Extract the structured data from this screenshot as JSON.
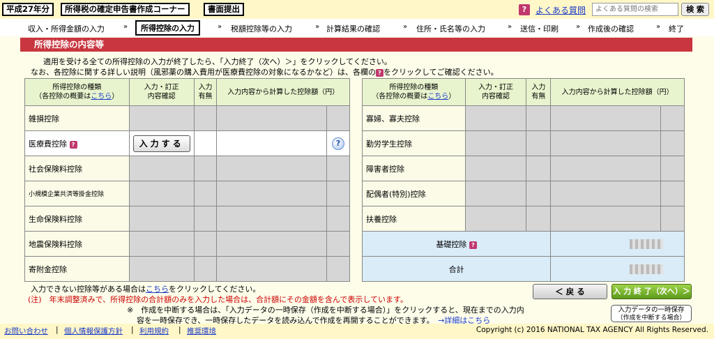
{
  "header": {
    "era": "平成27年分",
    "title": "所得税の確定申告書作成コーナー",
    "doc": "書面提出",
    "faq_icon": "?",
    "faq": "よくある質問",
    "search_placeholder": "よくある質問の検索",
    "search_btn": "検 索"
  },
  "nav": {
    "steps": [
      "収入・所得金額の入力",
      "所得控除の入力",
      "税額控除等の入力",
      "計算結果の確認",
      "住所・氏名等の入力",
      "送信・印刷",
      "作成後の確認",
      "終了"
    ],
    "arrow": "»"
  },
  "section": {
    "title": "所得控除の内容等",
    "intro1": "適用を受ける全ての所得控除の入力が終了したら、「入力終了（次へ）＞」をクリックしてください。",
    "intro2a": "なお、各控除に関する詳しい説明（風邪薬の購入費用が医療費控除の対象になるかなど）は、各欄の",
    "intro2b": "をクリックしてご確認ください。"
  },
  "table_headers": {
    "kind1": "所得控除の種類",
    "kind2a": "（各控除の概要は",
    "kind_link": "こちら",
    "kind2b": "）",
    "check1": "入力・訂正",
    "check2": "内容確認",
    "has1": "入力",
    "has2": "有無",
    "amount": "入力内容から計算した控除額（円）"
  },
  "left_rows": [
    "雑損控除",
    "医療費控除",
    "社会保険料控除",
    "小規模企業共済等掛金控除",
    "生命保険料控除",
    "地震保険料控除",
    "寄附金控除"
  ],
  "right_rows": [
    "寡婦、寡夫控除",
    "勤労学生控除",
    "障害者控除",
    "配偶者(特別)控除",
    "扶養控除"
  ],
  "input_btn": "入力する",
  "hint_icon": "?",
  "basic": "基礎控除",
  "total": "合計",
  "notes": {
    "line1a": "入力できない控除等がある場合は",
    "line1_link": "こちら",
    "line1b": "をクリックしてください。",
    "line2": "(注)　年末調整済みで、所得控除の合計額のみを入力した場合は、合計額にその金額を含んで表示しています。",
    "line3": "※　作成を中断する場合は、「入力データの一時保存（作成を中断する場合）」をクリックすると、現在までの入力内",
    "line4": "容を一時保存でき、一時保存したデータを読み込んで作成を再開することができます。",
    "detail_link": "→詳細はこちら"
  },
  "buttons": {
    "back": "＜ 戻 る",
    "next": "入 力 終 了（次へ）＞",
    "save1": "入力データの一時保存",
    "save2": "（作成を中断する場合）"
  },
  "footer": {
    "links": [
      "お問い合わせ",
      "個人情報保護方針",
      "利用規約",
      "推奨環境"
    ],
    "separator": "|",
    "copyright": "Copyright (c) 2016 NATIONAL TAX AGENCY All Rights Reserved."
  },
  "colors": {
    "section_red": "#c9363f",
    "header_yellow": "#fff7c8",
    "table_header_green": "#e8f4ce",
    "next_green": "#5d9a1c"
  }
}
